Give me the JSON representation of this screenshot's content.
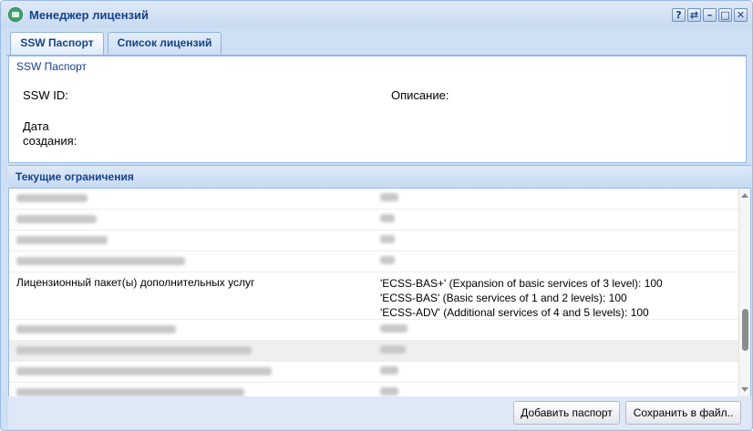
{
  "window": {
    "title": "Менеджер лицензий",
    "tool_buttons": [
      "?",
      "⇄",
      "–",
      "□",
      "✕"
    ]
  },
  "tabs": [
    {
      "label": "SSW Паспорт",
      "active": true
    },
    {
      "label": "Список лицензий",
      "active": false
    }
  ],
  "passport": {
    "section_title": "SSW Паспорт",
    "ssw_id_label": "SSW ID:",
    "description_label": "Описание:",
    "created_label_line1": "Дата",
    "created_label_line2": "создания:"
  },
  "limits": {
    "header": "Текущие ограничения",
    "package_row": {
      "name": "Лицензионный пакет(ы) дополнительных услуг",
      "values": [
        "'ECSS-BAS+' (Expansion of basic services of 3 level): 100",
        "'ECSS-BAS' (Basic services of 1 and 2 levels): 100",
        "'ECSS-ADV' (Additional services of 4 and 5 levels): 100"
      ]
    }
  },
  "footer": {
    "add_passport": "Добавить паспорт",
    "save_to_file": "Сохранить в файл.."
  },
  "colors": {
    "header_text": "#15428b",
    "border": "#99bbe8"
  }
}
